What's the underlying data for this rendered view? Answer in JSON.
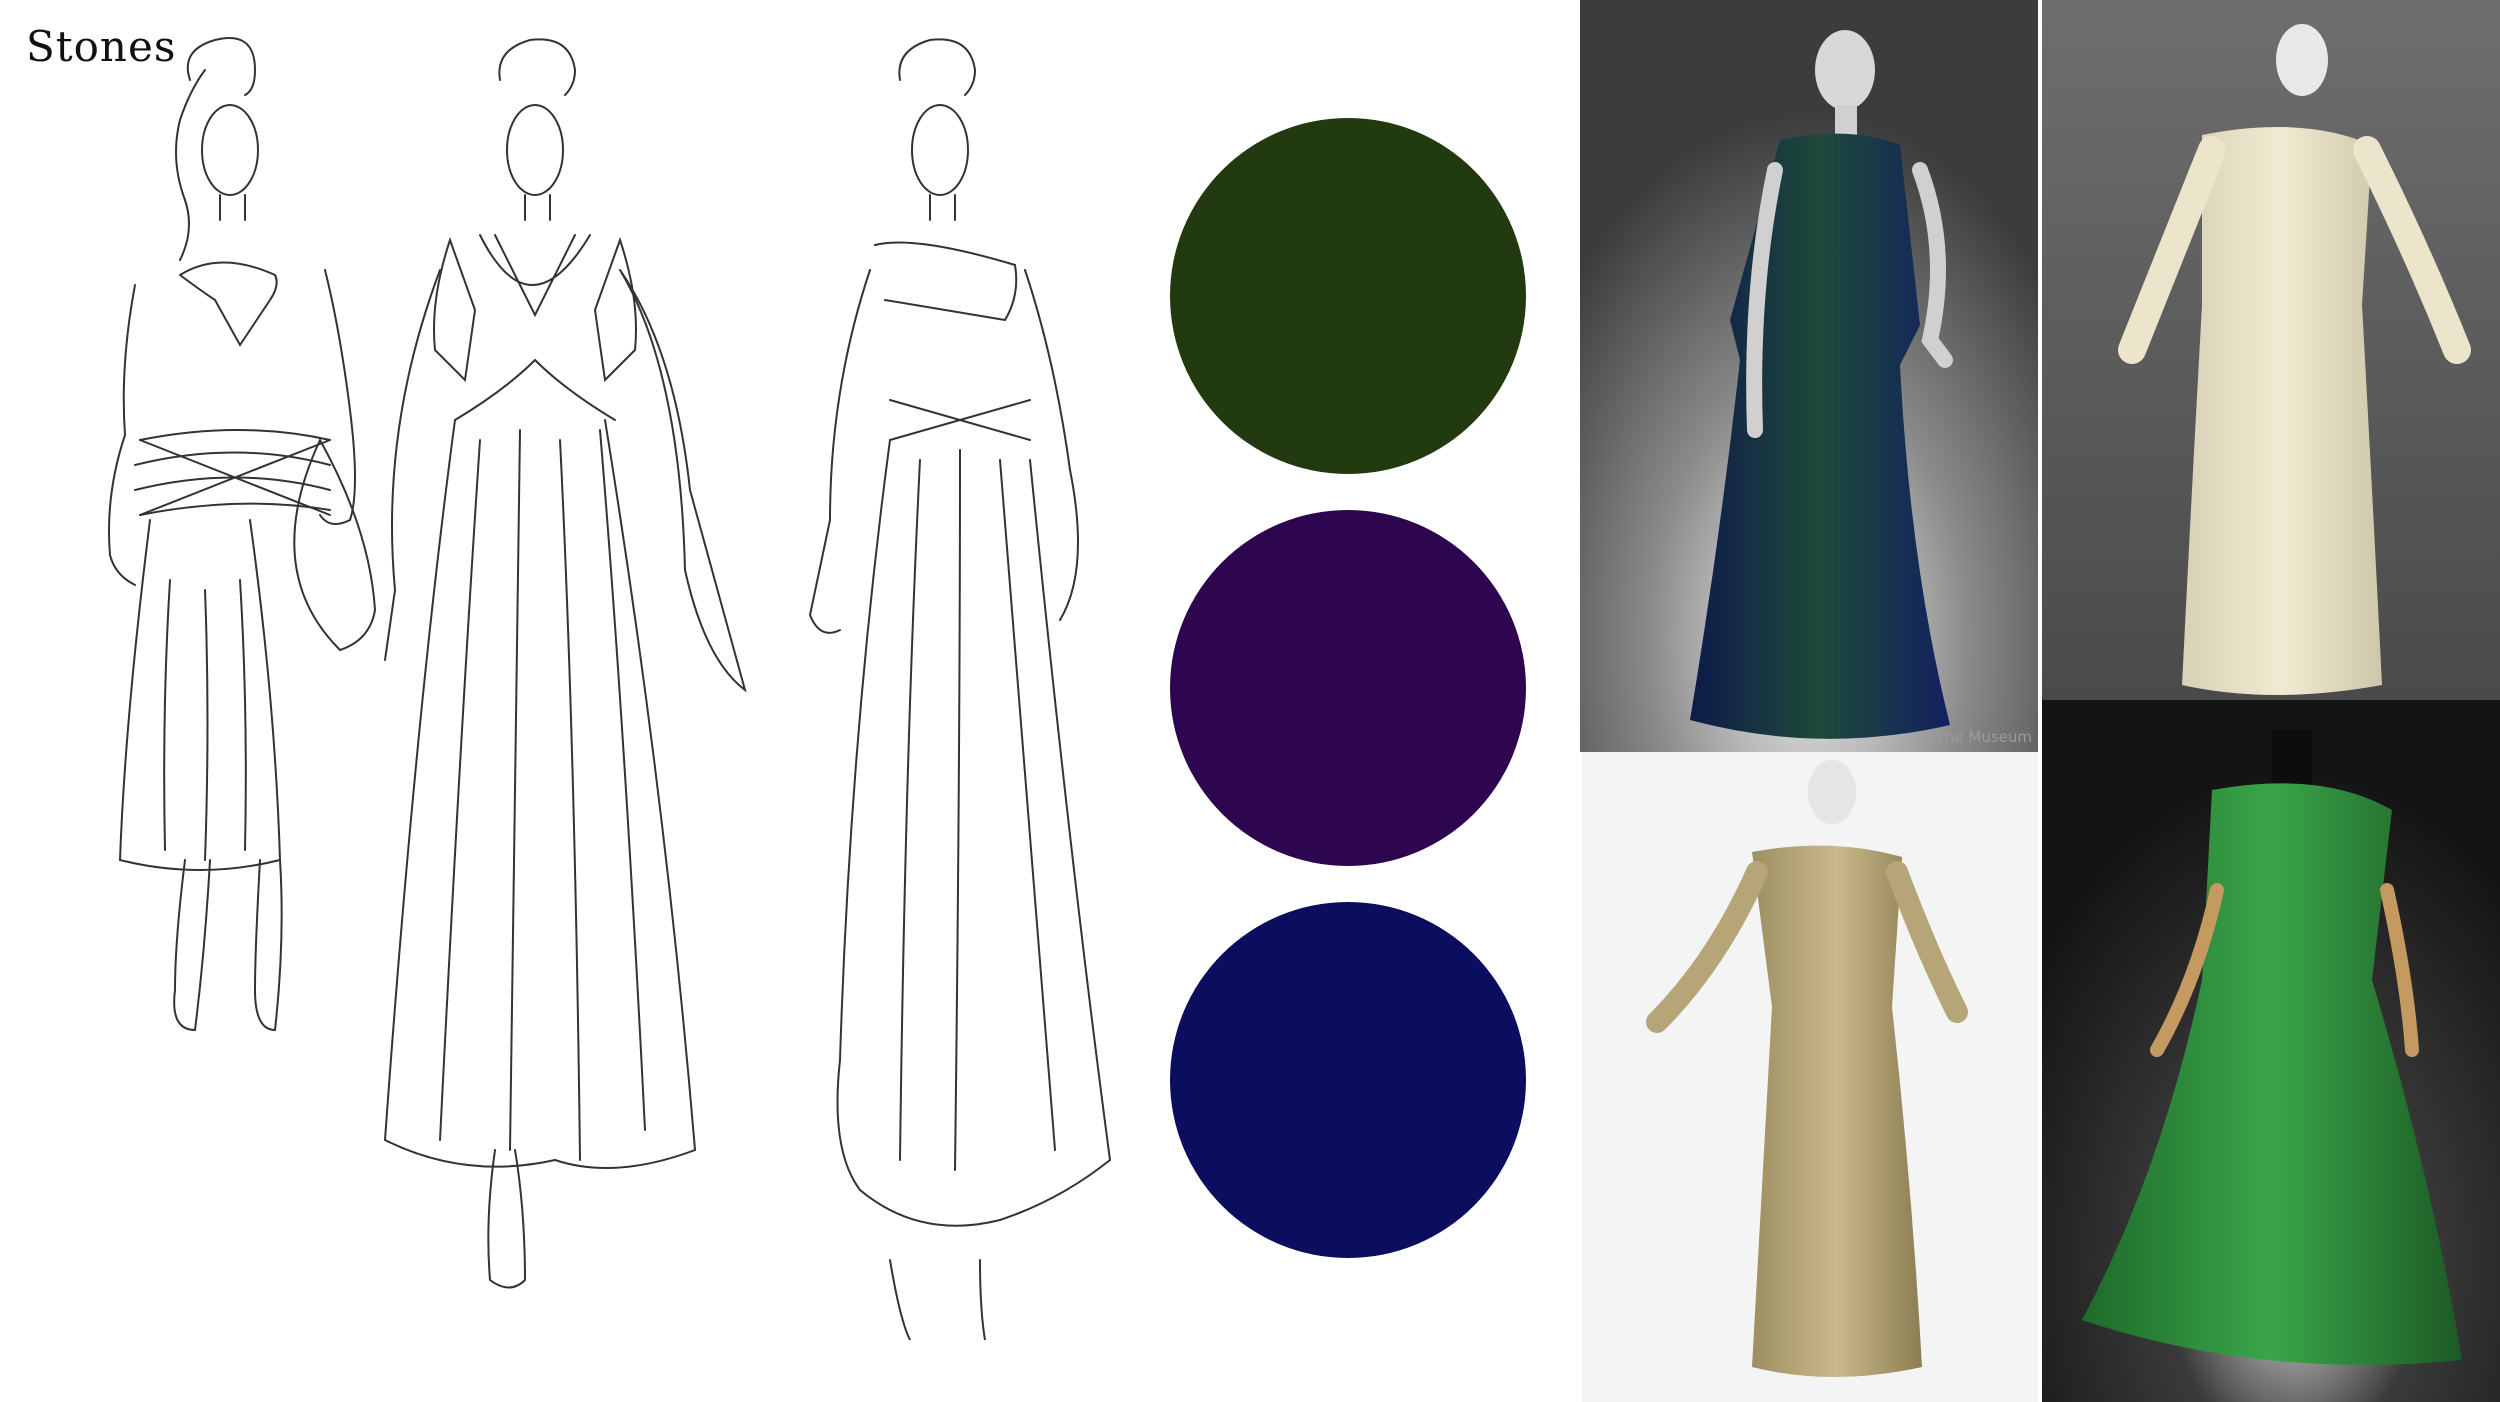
{
  "title": "Stones",
  "palette": [
    {
      "name": "deep green",
      "color": "#223a10"
    },
    {
      "name": "deep purple",
      "color": "#2e064f"
    },
    {
      "name": "navy blue",
      "color": "#0b0d5e"
    }
  ],
  "photos": {
    "top_left": {
      "watermark": "The Museum"
    }
  }
}
